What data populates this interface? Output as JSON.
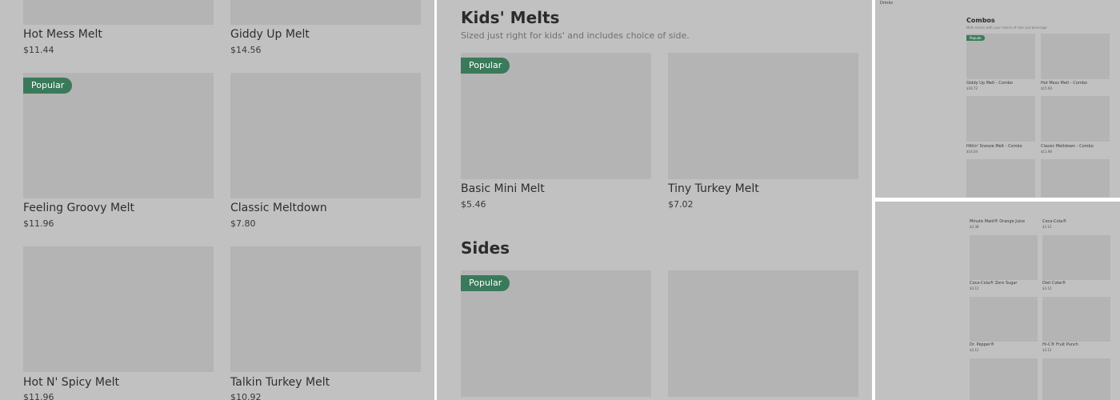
{
  "panel1": {
    "items": [
      {
        "name": "Hot Mess Melt",
        "price": "$11.44"
      },
      {
        "name": "Giddy Up Melt",
        "price": "$14.56"
      },
      {
        "badge": "Popular",
        "name": "Feeling Groovy Melt",
        "price": "$11.96"
      },
      {
        "name": "Classic Meltdown",
        "price": "$7.80"
      },
      {
        "name": "Hot N' Spicy Melt",
        "price": "$11.96"
      },
      {
        "name": "Talkin Turkey Melt",
        "price": "$10.92"
      }
    ]
  },
  "panel2": {
    "kids": {
      "title": "Kids' Melts",
      "subtitle": "Sized just right for kids' and includes choice of side.",
      "items": [
        {
          "badge": "Popular",
          "name": "Basic Mini Melt",
          "price": "$5.46"
        },
        {
          "name": "Tiny Turkey Melt",
          "price": "$7.02"
        }
      ]
    },
    "sides": {
      "title": "Sides",
      "items": [
        {
          "badge": "Popular"
        },
        {}
      ]
    }
  },
  "panel3": {
    "sidebar_label": "Drinks",
    "combos": {
      "title": "Combos",
      "subtitle": "Melt comes with your choice of side and beverage",
      "items": [
        {
          "badge": "Popular",
          "name": "Giddy Up Melt - Combo",
          "price": "$18.72"
        },
        {
          "name": "Hot Mess Melt - Combo",
          "price": "$15.60"
        },
        {
          "name": "Hittin' Snooze Melt - Combo",
          "price": "$14.04"
        },
        {
          "name": "Classic Meltdown - Combo",
          "price": "$11.96"
        }
      ]
    }
  },
  "panel4": {
    "items": [
      {
        "name": "Minute Maid® Orange Juice",
        "price": "$3.38"
      },
      {
        "name": "Coca-Cola®",
        "price": "$3.12"
      },
      {
        "name": "Coca-Cola® Zero Sugar",
        "price": "$3.12"
      },
      {
        "name": "Diet Coke®",
        "price": "$3.12"
      },
      {
        "name": "Dr. Pepper®",
        "price": "$3.12"
      },
      {
        "name": "Hi-C® Fruit Punch",
        "price": "$3.12"
      }
    ]
  }
}
